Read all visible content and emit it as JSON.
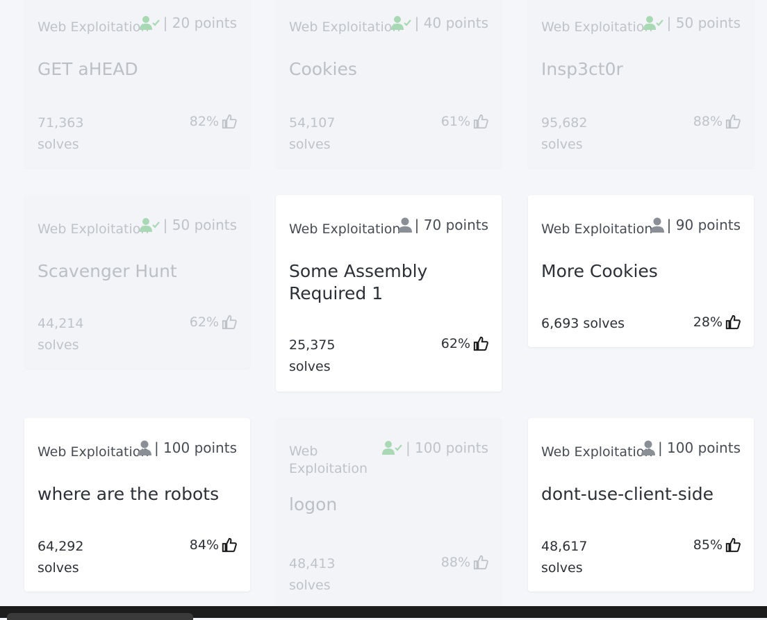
{
  "cards": [
    {
      "category": "Web Exploitation",
      "points": "| 20 points",
      "title": "GET aHEAD",
      "solves": "71,363",
      "solves_unit": "solves",
      "rating": "82%",
      "solved": true
    },
    {
      "category": "Web Exploitation",
      "points": "| 40 points",
      "title": "Cookies",
      "solves": "54,107",
      "solves_unit": "solves",
      "rating": "61%",
      "solved": true
    },
    {
      "category": "Web Exploitation",
      "points": "| 50 points",
      "title": "Insp3ct0r",
      "solves": "95,682",
      "solves_unit": "solves",
      "rating": "88%",
      "solved": true
    },
    {
      "category": "Web Exploitation",
      "points": "| 50 points",
      "title": "Scavenger Hunt",
      "solves": "44,214",
      "solves_unit": "solves",
      "rating": "62%",
      "solved": true
    },
    {
      "category": "Web Exploitation",
      "points": "| 70 points",
      "title": "Some Assembly Required 1",
      "solves": "25,375",
      "solves_unit": "solves",
      "rating": "62%",
      "solved": false
    },
    {
      "category": "Web Exploitation",
      "points": "| 90 points",
      "title": "More Cookies",
      "solves": "6,693 solves",
      "rating": "28%",
      "solved": false
    },
    {
      "category": "Web Exploitation",
      "points": "| 100 points",
      "title": "where are the robots",
      "solves": "64,292",
      "solves_unit": "solves",
      "rating": "84%",
      "solved": false
    },
    {
      "category": "Web Exploitation",
      "points": "| 100 points",
      "title": "logon",
      "solves": "48,413",
      "solves_unit": "solves",
      "rating": "88%",
      "solved": true
    },
    {
      "category": "Web Exploitation",
      "points": "| 100 points",
      "title": "dont-use-client-side",
      "solves": "48,617",
      "solves_unit": "solves",
      "rating": "85%",
      "solved": false
    }
  ],
  "icons": {
    "solved_user": "user-check-icon",
    "user": "user-icon",
    "rating": "thumbs-up-icon"
  },
  "colors": {
    "solved_icon": "#a8d8b4",
    "user_icon": "#8a8f96",
    "thumb": "#1a1a1a"
  }
}
